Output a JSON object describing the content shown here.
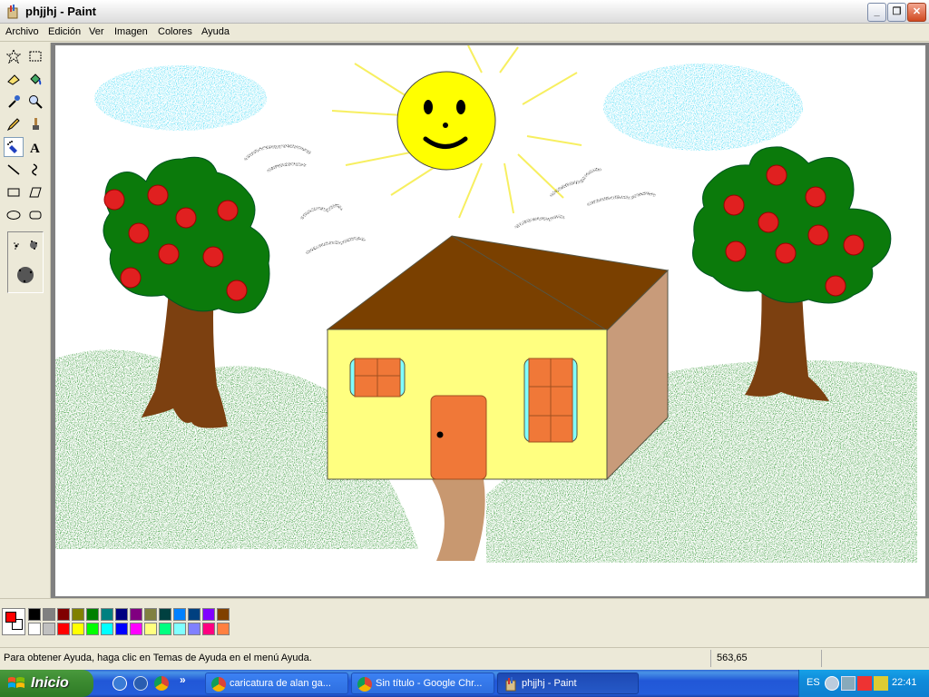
{
  "window": {
    "title": "phjjhj - Paint"
  },
  "menu": [
    "Archivo",
    "Edición",
    "Ver",
    "Imagen",
    "Colores",
    "Ayuda"
  ],
  "tools": [
    "free-select",
    "rect-select",
    "eraser",
    "fill",
    "color-picker",
    "magnifier",
    "pencil",
    "brush",
    "airbrush",
    "text",
    "line",
    "curve",
    "rectangle",
    "polygon",
    "ellipse",
    "rounded-rectangle"
  ],
  "active_tool": "airbrush",
  "palette": {
    "foreground": "#ff0000",
    "background": "#ffffff",
    "row1": [
      "#000000",
      "#808080",
      "#800000",
      "#808000",
      "#008000",
      "#008080",
      "#000080",
      "#800080",
      "#808040",
      "#004040",
      "#0080ff",
      "#004080",
      "#8000ff",
      "#804000"
    ],
    "row2": [
      "#ffffff",
      "#c0c0c0",
      "#ff0000",
      "#ffff00",
      "#00ff00",
      "#00ffff",
      "#0000ff",
      "#ff00ff",
      "#ffff80",
      "#00ff80",
      "#80ffff",
      "#8080ff",
      "#ff0080",
      "#ff8040"
    ]
  },
  "status": {
    "help_text": "Para obtener Ayuda, haga clic en Temas de Ayuda en el menú Ayuda.",
    "coords": "563,65"
  },
  "taskbar": {
    "start_label": "Inicio",
    "tasks": [
      {
        "label": "caricatura de alan ga..."
      },
      {
        "label": "Sin título - Google Chr..."
      },
      {
        "label": "phjjhj - Paint"
      }
    ],
    "lang": "ES",
    "clock": "22:41"
  }
}
